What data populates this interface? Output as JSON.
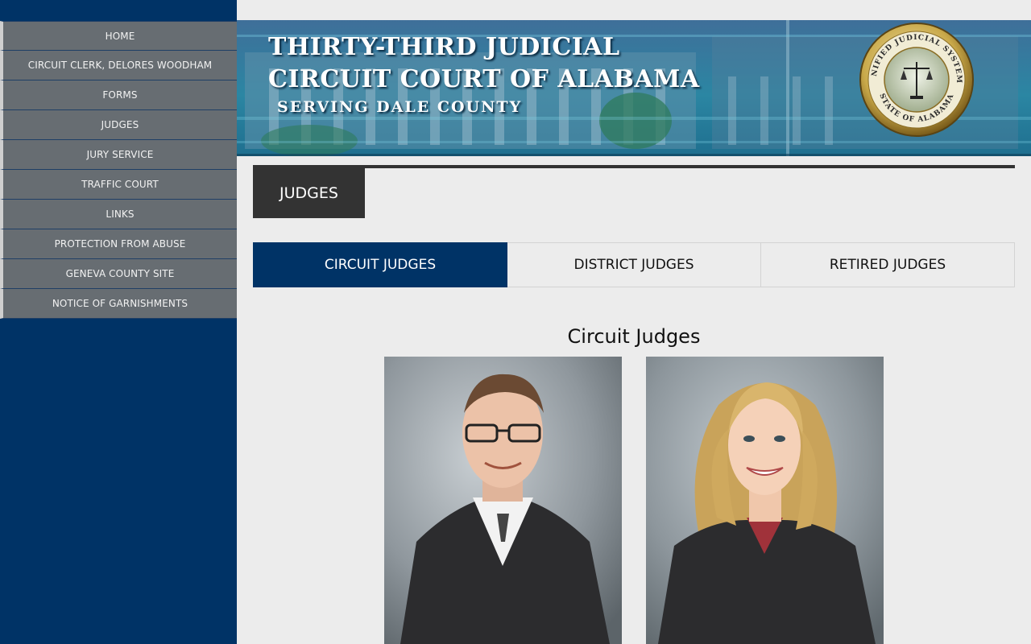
{
  "sidebar": {
    "items": [
      {
        "label": "HOME"
      },
      {
        "label": "CIRCUIT CLERK, DELORES WOODHAM"
      },
      {
        "label": "FORMS"
      },
      {
        "label": "JUDGES"
      },
      {
        "label": "JURY SERVICE"
      },
      {
        "label": "TRAFFIC COURT"
      },
      {
        "label": "LINKS"
      },
      {
        "label": "PROTECTION FROM ABUSE"
      },
      {
        "label": "GENEVA COUNTY SITE"
      },
      {
        "label": "NOTICE OF GARNISHMENTS"
      }
    ]
  },
  "header": {
    "title_line1": "THIRTY-THIRD JUDICIAL",
    "title_line2": "CIRCUIT COURT OF ALABAMA",
    "subtitle": "SERVING DALE COUNTY",
    "seal": {
      "top_text": "UNIFIED JUDICIAL SYSTEM",
      "bottom_text": "STATE OF ALABAMA"
    }
  },
  "main": {
    "page_heading": "JUDGES",
    "tabs": [
      {
        "label": "CIRCUIT JUDGES",
        "active": true
      },
      {
        "label": "DISTRICT JUDGES",
        "active": false
      },
      {
        "label": "RETIRED JUDGES",
        "active": false
      }
    ],
    "section_title": "Circuit Judges"
  },
  "colors": {
    "sidebar_bg": "#003366",
    "nav_item_bg": "#676d72",
    "active_tab_bg": "#003366",
    "heading_bg": "#333333",
    "page_bg": "#ececec"
  }
}
